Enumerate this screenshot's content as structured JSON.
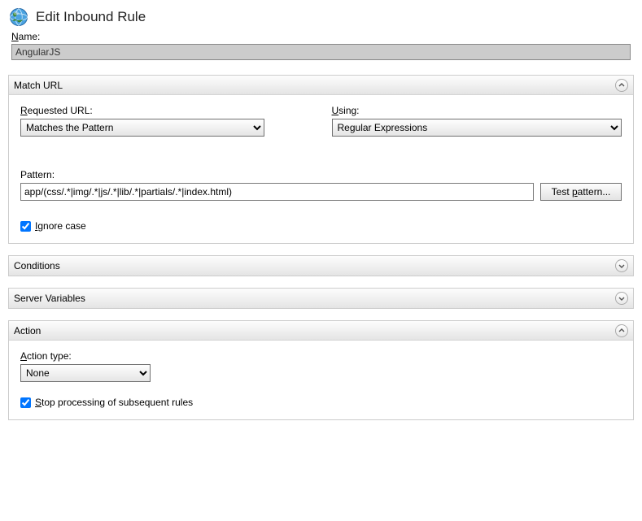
{
  "header": {
    "title": "Edit Inbound Rule"
  },
  "name": {
    "label": "Name:",
    "value": "AngularJS"
  },
  "matchUrl": {
    "title": "Match URL",
    "requestedLabel": "Requested URL:",
    "requestedValue": "Matches the Pattern",
    "usingLabel": "Using:",
    "usingValue": "Regular Expressions",
    "patternLabel": "Pattern:",
    "patternValue": "app/(css/.*|img/.*|js/.*|lib/.*|partials/.*|index.html)",
    "testButton": "Test pattern...",
    "ignoreCaseLabel": "Ignore case",
    "ignoreCaseChecked": true
  },
  "conditions": {
    "title": "Conditions"
  },
  "serverVars": {
    "title": "Server Variables"
  },
  "action": {
    "title": "Action",
    "actionTypeLabel": "Action type:",
    "actionTypeValue": "None",
    "stopProcessingLabel": "Stop processing of subsequent rules",
    "stopProcessingChecked": true
  }
}
